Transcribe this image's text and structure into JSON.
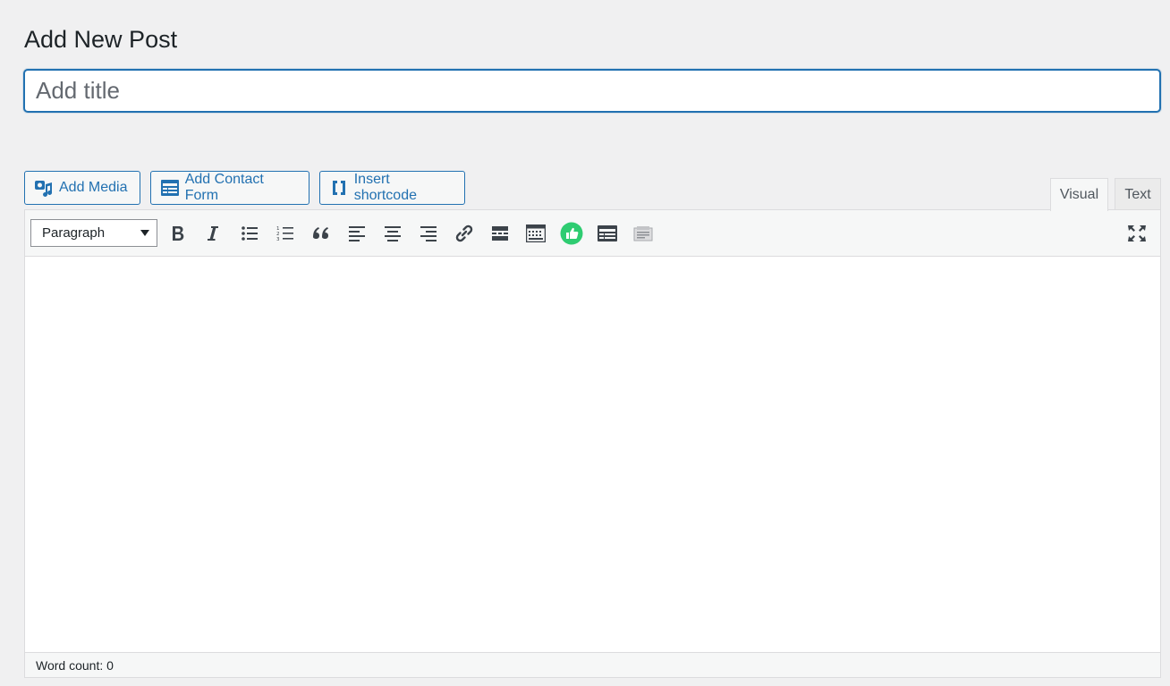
{
  "page": {
    "title": "Add New Post"
  },
  "title_field": {
    "placeholder": "Add title",
    "value": ""
  },
  "media_buttons": [
    {
      "label": "Add Media",
      "icon": "add-media-icon"
    },
    {
      "label": "Add Contact Form",
      "icon": "contact-form-icon"
    },
    {
      "label": "Insert shortcode",
      "icon": "shortcode-icon"
    }
  ],
  "editor_tabs": [
    {
      "label": "Visual",
      "active": true
    },
    {
      "label": "Text",
      "active": false
    }
  ],
  "toolbar": {
    "format_select": "Paragraph",
    "buttons": [
      "bold-icon",
      "italic-icon",
      "bulleted-list-icon",
      "numbered-list-icon",
      "blockquote-icon",
      "align-left-icon",
      "align-center-icon",
      "align-right-icon",
      "link-icon",
      "read-more-icon",
      "toolbar-toggle-icon",
      "thumbs-up-icon",
      "form-icon",
      "page-break-icon",
      "fullscreen-icon"
    ]
  },
  "colors": {
    "accent": "#2271b1",
    "thumbs_up": "#2ecc71",
    "background": "#f0f0f1"
  },
  "status": {
    "word_count": "Word count: 0"
  }
}
